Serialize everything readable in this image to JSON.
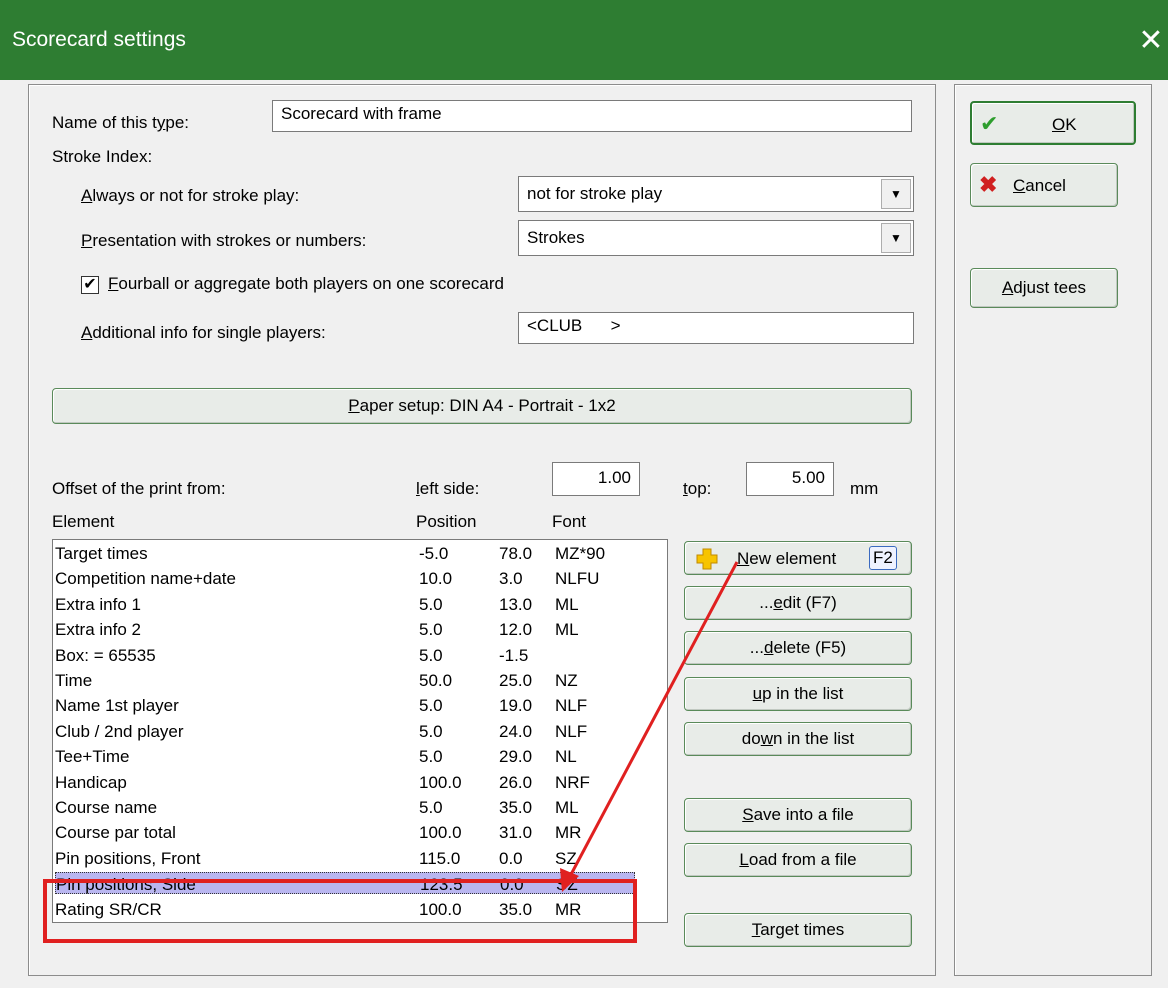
{
  "window": {
    "title": "Scorecard settings"
  },
  "form": {
    "name_label": "Name of this type:",
    "name_value": "Scorecard with frame",
    "stroke_index_label": "Stroke Index:",
    "always_label": "Always or not for stroke play:",
    "always_value": "not for stroke play",
    "presentation_label": "Presentation with strokes or numbers:",
    "presentation_value": "Strokes",
    "fourball_label": "Fourball or aggregate both players on one scorecard",
    "fourball_checked": true,
    "additional_label": "Additional info for single players:",
    "additional_value": "<CLUB      >",
    "paper_setup_label": "Paper setup: DIN A4 - Portrait - 1x2",
    "offset_label": "Offset of the print from:",
    "left_side_label": "left side:",
    "left_side_value": "1.00",
    "top_label": "top:",
    "top_value": "5.00",
    "unit": "mm"
  },
  "table": {
    "headers": {
      "element": "Element",
      "position": "Position",
      "font": "Font"
    },
    "rows": [
      {
        "name": "Target times",
        "x": "-5.0",
        "y": "78.0",
        "font": "MZ*90"
      },
      {
        "name": "Competition name+date",
        "x": "10.0",
        "y": "3.0",
        "font": "NLFU"
      },
      {
        "name": "Extra info 1",
        "x": "5.0",
        "y": "13.0",
        "font": "ML"
      },
      {
        "name": "Extra info 2",
        "x": "5.0",
        "y": "12.0",
        "font": "ML"
      },
      {
        "name": "Box: =   65535",
        "x": "5.0",
        "y": "-1.5",
        "font": ""
      },
      {
        "name": "Time",
        "x": "50.0",
        "y": "25.0",
        "font": "NZ"
      },
      {
        "name": "Name 1st player",
        "x": "5.0",
        "y": "19.0",
        "font": "NLF"
      },
      {
        "name": "Club / 2nd player",
        "x": "5.0",
        "y": "24.0",
        "font": "NLF"
      },
      {
        "name": "Tee+Time",
        "x": "5.0",
        "y": "29.0",
        "font": "NL"
      },
      {
        "name": "Handicap",
        "x": "100.0",
        "y": "26.0",
        "font": "NRF"
      },
      {
        "name": "Course name",
        "x": "5.0",
        "y": "35.0",
        "font": "ML"
      },
      {
        "name": "Course par total",
        "x": "100.0",
        "y": "31.0",
        "font": "MR"
      },
      {
        "name": "Pin positions, Front",
        "x": "115.0",
        "y": "0.0",
        "font": "SZ"
      },
      {
        "name": "Pin positions, Side",
        "x": "123.5",
        "y": "0.0",
        "font": "SZ"
      },
      {
        "name": "Rating SR/CR",
        "x": "100.0",
        "y": "35.0",
        "font": "MR"
      }
    ]
  },
  "buttons": {
    "new_element": "New element",
    "new_element_key": "F2",
    "edit": "...edit (F7)",
    "delete": "...delete (F5)",
    "up": "up in the list",
    "down": "down in the list",
    "save": "Save into a file",
    "load": "Load from a file",
    "target_times": "Target times",
    "ok": "OK",
    "cancel": "Cancel",
    "adjust_tees": "Adjust tees"
  },
  "colors": {
    "titlebar": "#2e7d32",
    "selection": "#b9b6f0",
    "annotation": "#e02020"
  }
}
